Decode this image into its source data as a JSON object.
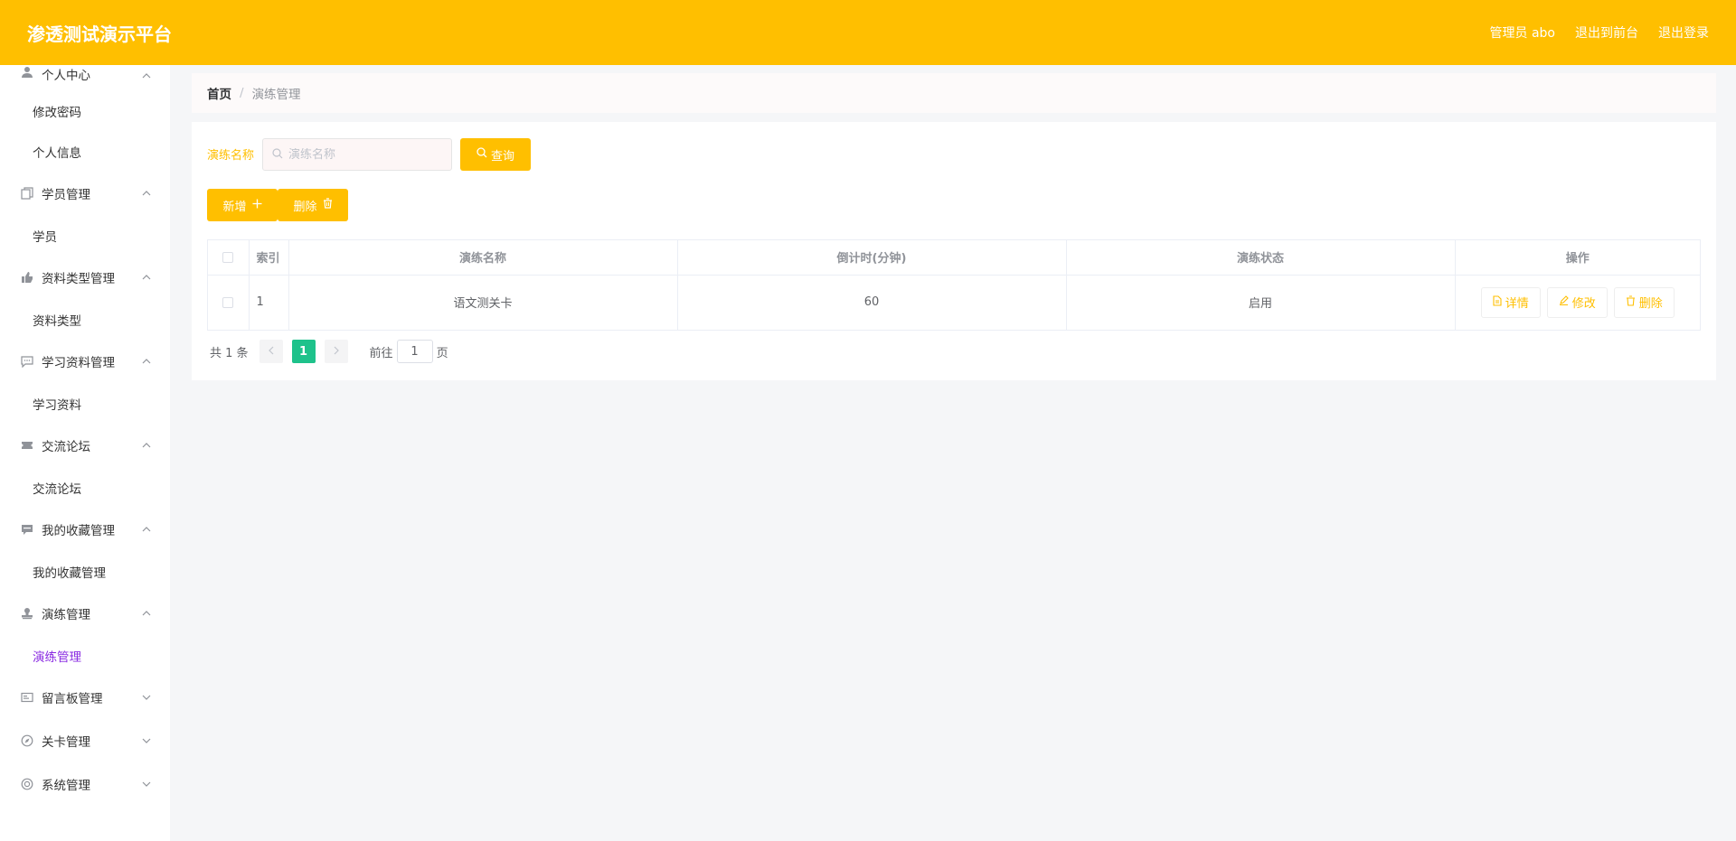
{
  "header": {
    "title": "渗透测试演示平台",
    "user_label": "管理员 abo",
    "back_front": "退出到前台",
    "logout": "退出登录",
    "bg_color": "#ffbf00"
  },
  "sidebar": {
    "groups": [
      {
        "title": "个人中心",
        "icon": "user-icon",
        "expanded": true,
        "items": [
          "修改密码",
          "个人信息"
        ]
      },
      {
        "title": "学员管理",
        "icon": "copy-icon",
        "expanded": true,
        "items": [
          "学员"
        ]
      },
      {
        "title": "资料类型管理",
        "icon": "thumbs-up-icon",
        "expanded": true,
        "items": [
          "资料类型"
        ]
      },
      {
        "title": "学习资料管理",
        "icon": "chat-icon",
        "expanded": true,
        "items": [
          "学习资料"
        ]
      },
      {
        "title": "交流论坛",
        "icon": "ticket-icon",
        "expanded": true,
        "items": [
          "交流论坛"
        ]
      },
      {
        "title": "我的收藏管理",
        "icon": "message-icon",
        "expanded": true,
        "items": [
          "我的收藏管理"
        ]
      },
      {
        "title": "演练管理",
        "icon": "stamp-icon",
        "expanded": true,
        "items": [
          "演练管理"
        ],
        "active_item": "演练管理"
      },
      {
        "title": "留言板管理",
        "icon": "postcard-icon",
        "expanded": false,
        "items": []
      },
      {
        "title": "关卡管理",
        "icon": "compass-icon",
        "expanded": false,
        "items": []
      },
      {
        "title": "系统管理",
        "icon": "help-icon",
        "expanded": false,
        "items": []
      }
    ],
    "active_color": "#8a2be2"
  },
  "breadcrumb": {
    "home": "首页",
    "separator": "/",
    "current": "演练管理"
  },
  "search": {
    "label": "演练名称",
    "placeholder": "演练名称",
    "value": "",
    "query_button": "查询"
  },
  "toolbar": {
    "add_label": "新增",
    "delete_label": "删除"
  },
  "table": {
    "columns": [
      "索引",
      "演练名称",
      "倒计时(分钟)",
      "演练状态",
      "操作"
    ],
    "rows": [
      {
        "index": "1",
        "name": "语文测关卡",
        "countdown": "60",
        "status": "启用"
      }
    ],
    "actions": [
      "详情",
      "修改",
      "删除"
    ]
  },
  "pagination": {
    "total_text": "共 1 条",
    "current_page": "1",
    "goto_prefix": "前往",
    "goto_value": "1",
    "goto_suffix": "页"
  },
  "colors": {
    "accent": "#ffbf00",
    "page_active": "#1ec28b"
  }
}
